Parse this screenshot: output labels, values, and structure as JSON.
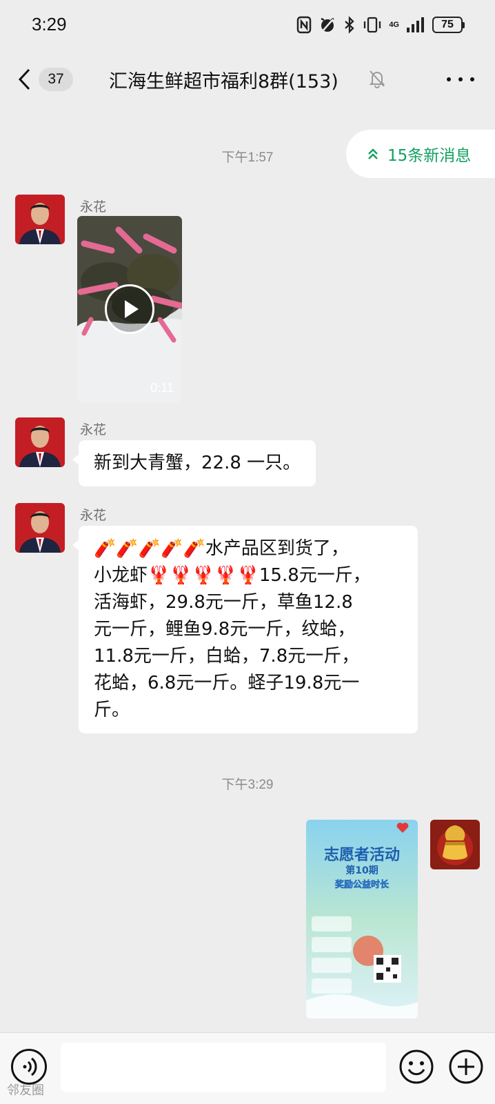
{
  "status_bar": {
    "time": "3:29",
    "network": "4G",
    "battery": "75"
  },
  "header": {
    "unread_count": "37",
    "title": "汇海生鲜超市福利8群(153)"
  },
  "new_messages_pill": {
    "label": "15条新消息"
  },
  "messages": [
    {
      "type": "timestamp",
      "text": "下午1:57"
    },
    {
      "type": "video",
      "sender": "永花",
      "duration": "0:11"
    },
    {
      "type": "text",
      "sender": "永花",
      "text": "新到大青蟹，22.8 一只。"
    },
    {
      "type": "text",
      "sender": "永花",
      "lines": [
        "🧨🧨🧨🧨🧨水产品区到货了，",
        "小龙虾🦞🦞🦞🦞🦞15.8元一斤，",
        "活海虾，29.8元一斤，草鱼12.8",
        "元一斤，鲤鱼9.8元一斤，纹蛤，",
        "11.8元一斤，白蛤，7.8元一斤，",
        "花蛤，6.8元一斤。蛏子19.8元一",
        "斤。"
      ]
    },
    {
      "type": "timestamp",
      "text": "下午3:29"
    },
    {
      "type": "image",
      "sender": "self",
      "poster_lines": [
        "志愿者活动",
        "第10期",
        "奖励公益时长"
      ]
    }
  ],
  "input_bar": {
    "placeholder": ""
  },
  "watermark": "邻友圈",
  "colors": {
    "accent_green": "#12a060",
    "background": "#ededed",
    "bubble": "#ffffff"
  }
}
